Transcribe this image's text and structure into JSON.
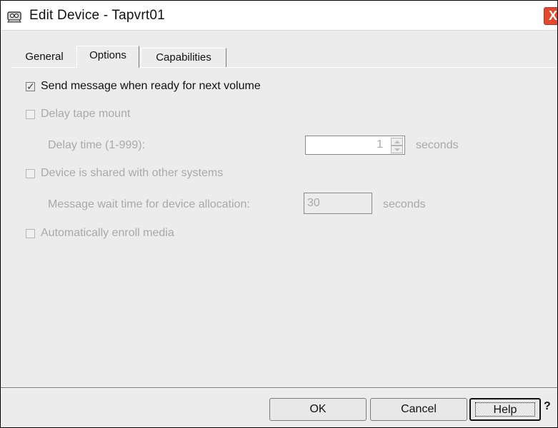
{
  "window": {
    "title": "Edit Device - Tapvrt01",
    "close_label": "X"
  },
  "tabs": [
    {
      "label": "General",
      "active": false
    },
    {
      "label": "Options",
      "active": true
    },
    {
      "label": "Capabilities",
      "active": false
    }
  ],
  "options": {
    "send_message": {
      "label": "Send message when ready for next volume",
      "checked": true,
      "enabled": true
    },
    "delay_tape_mount": {
      "label": "Delay tape mount",
      "checked": false,
      "enabled": false
    },
    "delay_time": {
      "label": "Delay time (1-999):",
      "value": "1",
      "unit": "seconds"
    },
    "shared_device": {
      "label": "Device is shared with other systems",
      "checked": false,
      "enabled": false
    },
    "message_wait": {
      "label": "Message wait time for device allocation:",
      "value": "30",
      "unit": "seconds"
    },
    "auto_enroll": {
      "label": "Automatically enroll media",
      "checked": false,
      "enabled": false
    }
  },
  "buttons": {
    "ok": "OK",
    "cancel": "Cancel",
    "help": "Help",
    "question": "?"
  }
}
